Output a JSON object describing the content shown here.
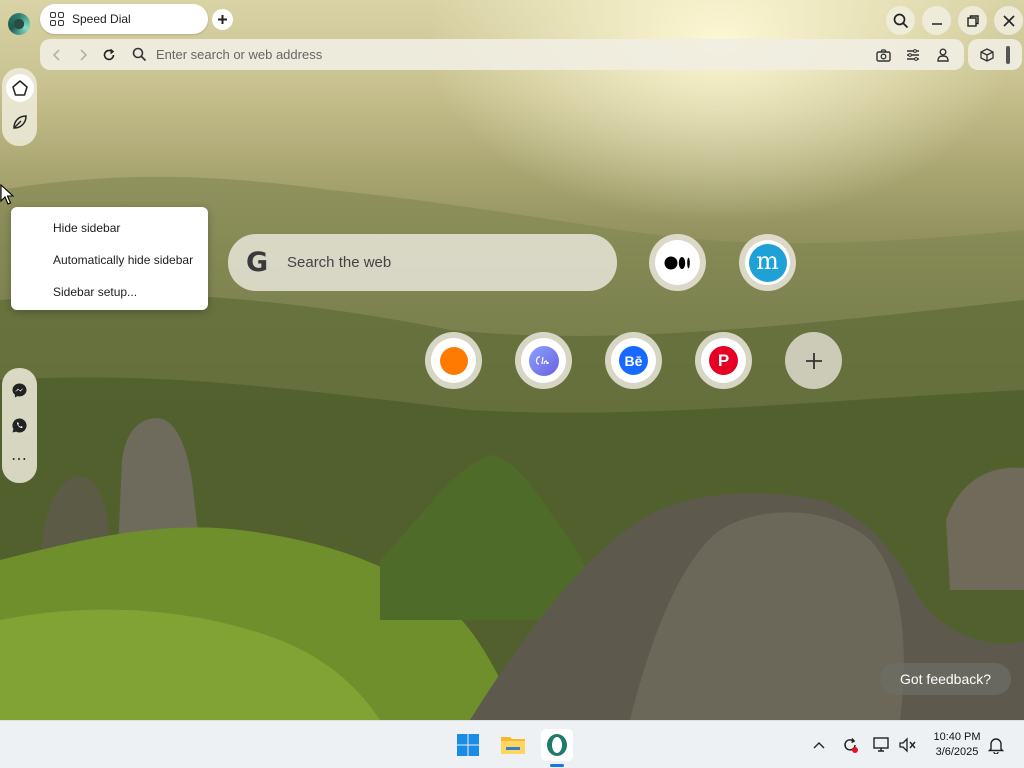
{
  "browser": {
    "tab": {
      "title": "Speed Dial",
      "icon": "speed-dial-grid-icon"
    },
    "new_tab_icon": "plus-icon",
    "window_controls": [
      "search-tabs-icon",
      "minimize-icon",
      "restore-icon",
      "close-icon"
    ],
    "address_bar": {
      "placeholder": "Enter search or web address",
      "value": "",
      "icons": [
        "back-icon",
        "forward-icon",
        "reload-icon",
        "search-icon",
        "camera-icon",
        "easy-setup-icon",
        "profile-icon"
      ]
    },
    "extras": [
      "cube-icon",
      "scrollbar-handle"
    ]
  },
  "sidebar": {
    "top_items": [
      "home-icon",
      "aria-icon"
    ],
    "bottom_items": [
      "messenger-icon",
      "whatsapp-icon",
      "more-icon"
    ],
    "more_label": "⋯"
  },
  "context_menu": {
    "items": [
      {
        "label": "Hide sidebar"
      },
      {
        "label": "Automatically hide sidebar"
      },
      {
        "label": "Sidebar setup..."
      }
    ]
  },
  "speed_dial": {
    "search": {
      "logo": "G",
      "placeholder": "Search the web"
    },
    "tiles": [
      {
        "name": "medium",
        "icon": "medium-icon",
        "color": "#000000"
      },
      {
        "name": "mindmeister",
        "icon": "m-letter-icon",
        "color": "#1da1d6"
      },
      {
        "name": "orange-site",
        "icon": "orange-circle-icon",
        "color": "#ff7a00"
      },
      {
        "name": "calendly",
        "icon": "calendly-icon",
        "color": "#6b7df0"
      },
      {
        "name": "behance",
        "icon": "behance-icon",
        "color": "#1769ff",
        "label": "Bē"
      },
      {
        "name": "pinterest",
        "icon": "pinterest-icon",
        "color": "#e60023",
        "label": "P"
      },
      {
        "name": "add-site",
        "icon": "plus-icon",
        "label": "+"
      }
    ]
  },
  "feedback": {
    "label": "Got feedback?"
  },
  "taskbar": {
    "apps": [
      "windows-start-icon",
      "file-explorer-icon",
      "opera-icon"
    ],
    "tray": [
      "show-hidden-icons",
      "update-icon",
      "network-icon",
      "volume-muted-icon",
      "notification-icon"
    ],
    "time": "10:40 PM",
    "date": "3/6/2025"
  }
}
